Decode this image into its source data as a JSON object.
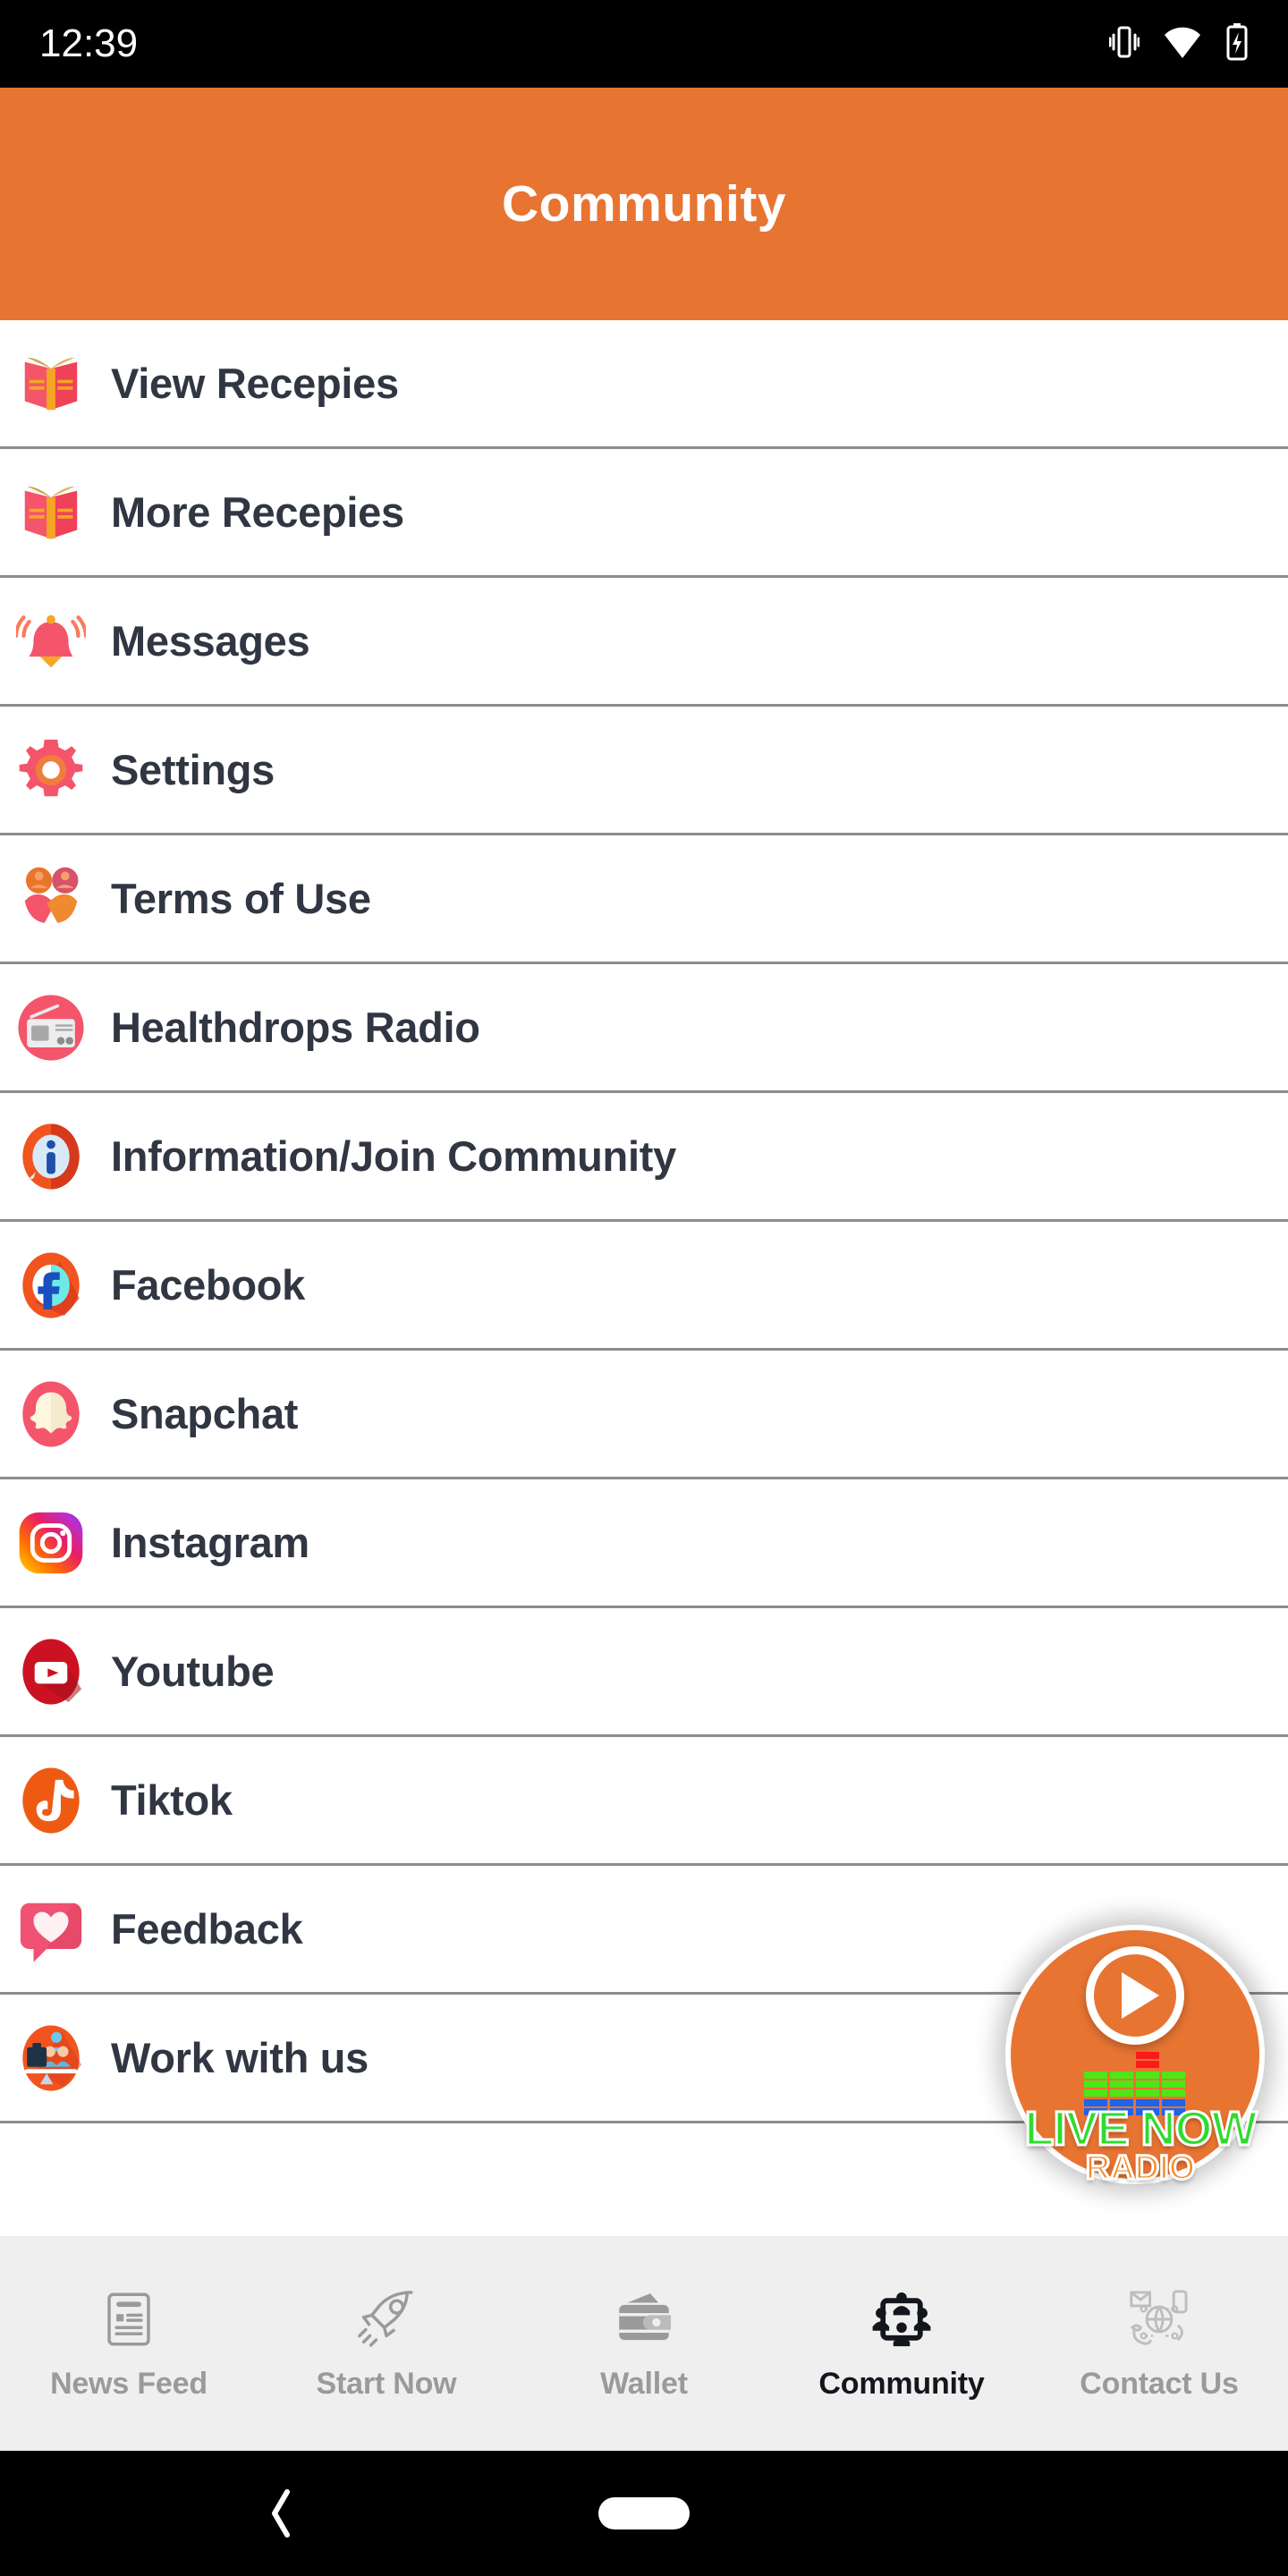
{
  "statusbar": {
    "time": "12:39",
    "icons": [
      "vibrate-icon",
      "wifi-icon",
      "battery-charging-icon"
    ]
  },
  "header": {
    "title": "Community",
    "background_color": "#E87432",
    "text_color": "#FFFFFF"
  },
  "list": {
    "divider_color": "#8C8C8C",
    "label_color": "#303642",
    "items": [
      {
        "label": "View Recepies",
        "icon": "open-book-icon"
      },
      {
        "label": "More Recepies",
        "icon": "open-book-icon"
      },
      {
        "label": "Messages",
        "icon": "ringing-bell-icon"
      },
      {
        "label": "Settings",
        "icon": "gear-icon"
      },
      {
        "label": "Terms of Use",
        "icon": "handshake-people-icon"
      },
      {
        "label": "Healthdrops Radio",
        "icon": "radio-icon"
      },
      {
        "label": "Information/Join Community",
        "icon": "info-circle-icon"
      },
      {
        "label": "Facebook",
        "icon": "facebook-icon"
      },
      {
        "label": "Snapchat",
        "icon": "snapchat-ghost-icon"
      },
      {
        "label": "Instagram",
        "icon": "instagram-icon"
      },
      {
        "label": "Youtube",
        "icon": "youtube-play-icon"
      },
      {
        "label": "Tiktok",
        "icon": "tiktok-note-icon"
      },
      {
        "label": "Feedback",
        "icon": "heart-speech-bubble-icon"
      },
      {
        "label": "Work with us",
        "icon": "briefcase-team-icon"
      }
    ]
  },
  "radio_fab": {
    "play_icon": "play-icon",
    "equalizer_icon": "equalizer-icon",
    "live_text": "LIVE NOW",
    "radio_text": "RADIO",
    "background_color": "#E87432",
    "live_color": "#2FDB2F",
    "radio_color": "#F28A28"
  },
  "bottomnav": {
    "background_color": "#EFEFEF",
    "inactive_color": "#9A9A9A",
    "active_color": "#13161C",
    "items": [
      {
        "label": "News Feed",
        "icon": "newspaper-icon",
        "active": false
      },
      {
        "label": "Start Now",
        "icon": "rocket-icon",
        "active": false
      },
      {
        "label": "Wallet",
        "icon": "wallet-icon",
        "active": false
      },
      {
        "label": "Community",
        "icon": "people-group-icon",
        "active": true
      },
      {
        "label": "Contact Us",
        "icon": "globe-contact-icon",
        "active": false
      }
    ]
  },
  "androidnav": {
    "back_icon": "back-chevron-icon",
    "home_icon": "home-pill-icon"
  }
}
